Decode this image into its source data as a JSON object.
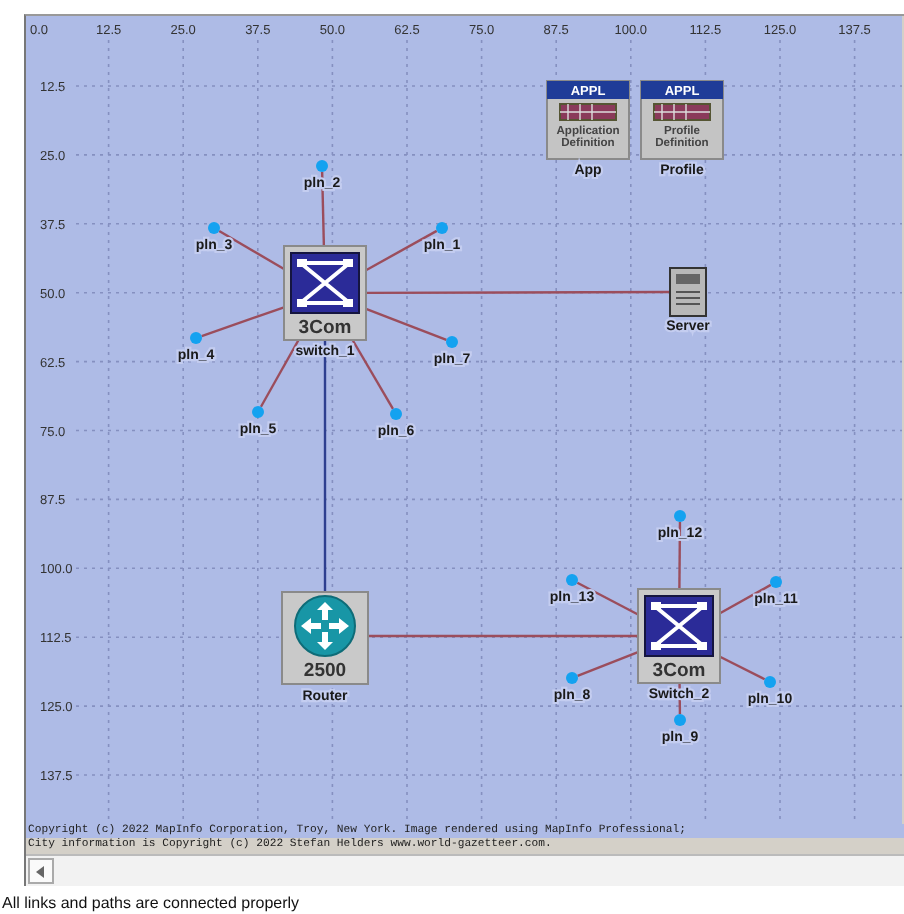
{
  "ruler": {
    "x_ticks": [
      "0.0",
      "12.5",
      "25.0",
      "37.5",
      "50.0",
      "62.5",
      "75.0",
      "87.5",
      "100.0",
      "112.5",
      "125.0",
      "137.5"
    ],
    "y_ticks": [
      "12.5",
      "25.0",
      "37.5",
      "50.0",
      "62.5",
      "75.0",
      "87.5",
      "100.0",
      "112.5",
      "125.0",
      "137.5"
    ]
  },
  "nodes": [
    {
      "kind": "config",
      "header": "APPL",
      "caption": "Application Definition",
      "label": "App"
    },
    {
      "kind": "config",
      "header": "APPL",
      "caption": "Profile Definition",
      "label": "Profile"
    },
    {
      "kind": "endpoint",
      "label": "pln_2"
    },
    {
      "kind": "endpoint",
      "label": "pln_3"
    },
    {
      "kind": "endpoint",
      "label": "pln_1"
    },
    {
      "kind": "switch",
      "brand": "3Com",
      "label": "switch_1"
    },
    {
      "kind": "server",
      "label": "Server"
    },
    {
      "kind": "endpoint",
      "label": "pln_4"
    },
    {
      "kind": "endpoint",
      "label": "pln_7"
    },
    {
      "kind": "endpoint",
      "label": "pln_5"
    },
    {
      "kind": "endpoint",
      "label": "pln_6"
    },
    {
      "kind": "endpoint",
      "label": "pln_12"
    },
    {
      "kind": "endpoint",
      "label": "pln_13"
    },
    {
      "kind": "endpoint",
      "label": "pln_11"
    },
    {
      "kind": "router",
      "model": "2500",
      "label": "Router"
    },
    {
      "kind": "endpoint",
      "label": "pln_8"
    },
    {
      "kind": "switch",
      "brand": "3Com",
      "label": "Switch_2"
    },
    {
      "kind": "endpoint",
      "label": "pln_10"
    },
    {
      "kind": "endpoint",
      "label": "pln_9"
    }
  ],
  "copyright": [
    "Copyright (c) 2022 MapInfo Corporation, Troy, New York. Image rendered using MapInfo Professional;",
    "City information is Copyright (c) 2022 Stefan Helders www.world-gazetteer.com."
  ],
  "status_bar": {
    "text": "All links and paths are connected properly"
  }
}
